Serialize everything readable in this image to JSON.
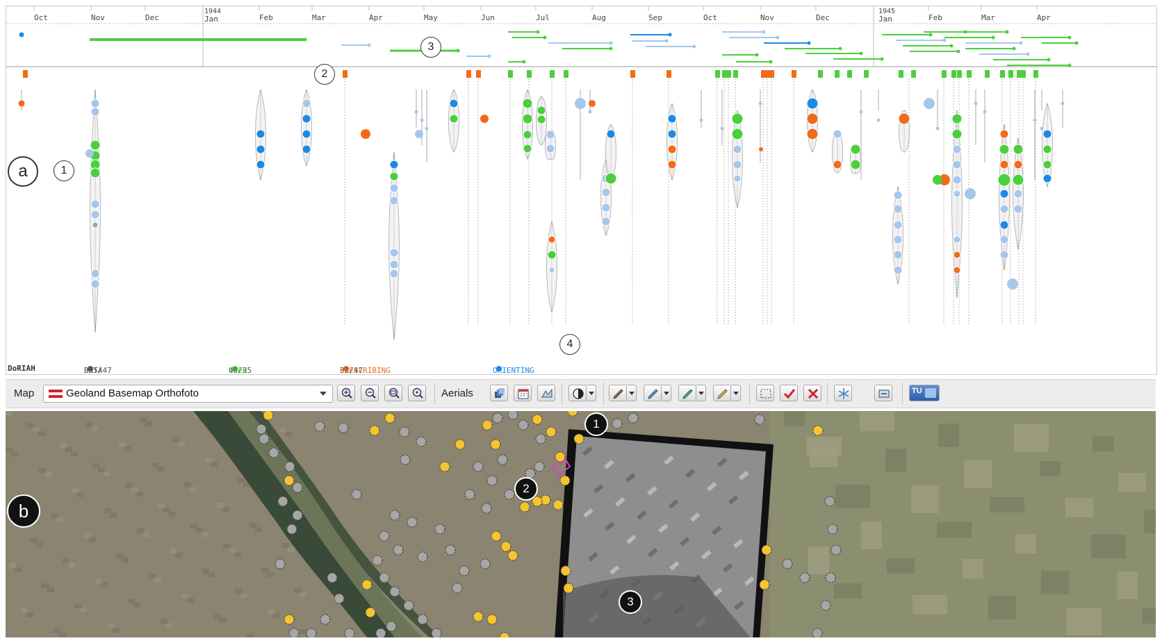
{
  "timeline": {
    "years": [
      {
        "label": "1944",
        "sub": "Jan"
      },
      {
        "label": "1945",
        "sub": "Jan"
      }
    ],
    "months": [
      "Oct",
      "Nov",
      "Dec",
      "Feb",
      "Mar",
      "Apr",
      "May",
      "Jun",
      "Jul",
      "Aug",
      "Sep",
      "Oct",
      "Nov",
      "Dec",
      "Feb",
      "Mar",
      "Apr"
    ],
    "callouts": [
      "1",
      "2",
      "3",
      "4"
    ],
    "side_label": "a"
  },
  "footer": {
    "brand": "DoRIAH",
    "data_label": "DATA",
    "data_count": "335/47",
    "user_label": "USER",
    "user_count": "40/35",
    "prescribing_label": "PRESCRIBING",
    "prescribing_count": "32/47",
    "orienting_label": "ORIENTING"
  },
  "toolbar": {
    "map_label": "Map",
    "basemap_value": "Geoland Basemap Orthofoto",
    "aerials_label": "Aerials",
    "zoom_in_icon": "zoom-in-icon",
    "zoom_out_icon": "zoom-out-icon",
    "zoom_full_icon": "zoom-extent-icon",
    "zoom_select_icon": "zoom-selection-icon",
    "tu_logo": "TU"
  },
  "map": {
    "side_label": "b",
    "callouts": [
      "1",
      "2",
      "3"
    ]
  },
  "colors": {
    "user": "#4ccf3c",
    "prescribing": "#f26a1b",
    "orienting": "#1e88e5",
    "data": "#555555",
    "light_blue": "#a7c7ea",
    "marker_yellow": "#f5c431",
    "marker_gray": "#a6a6a6"
  }
}
